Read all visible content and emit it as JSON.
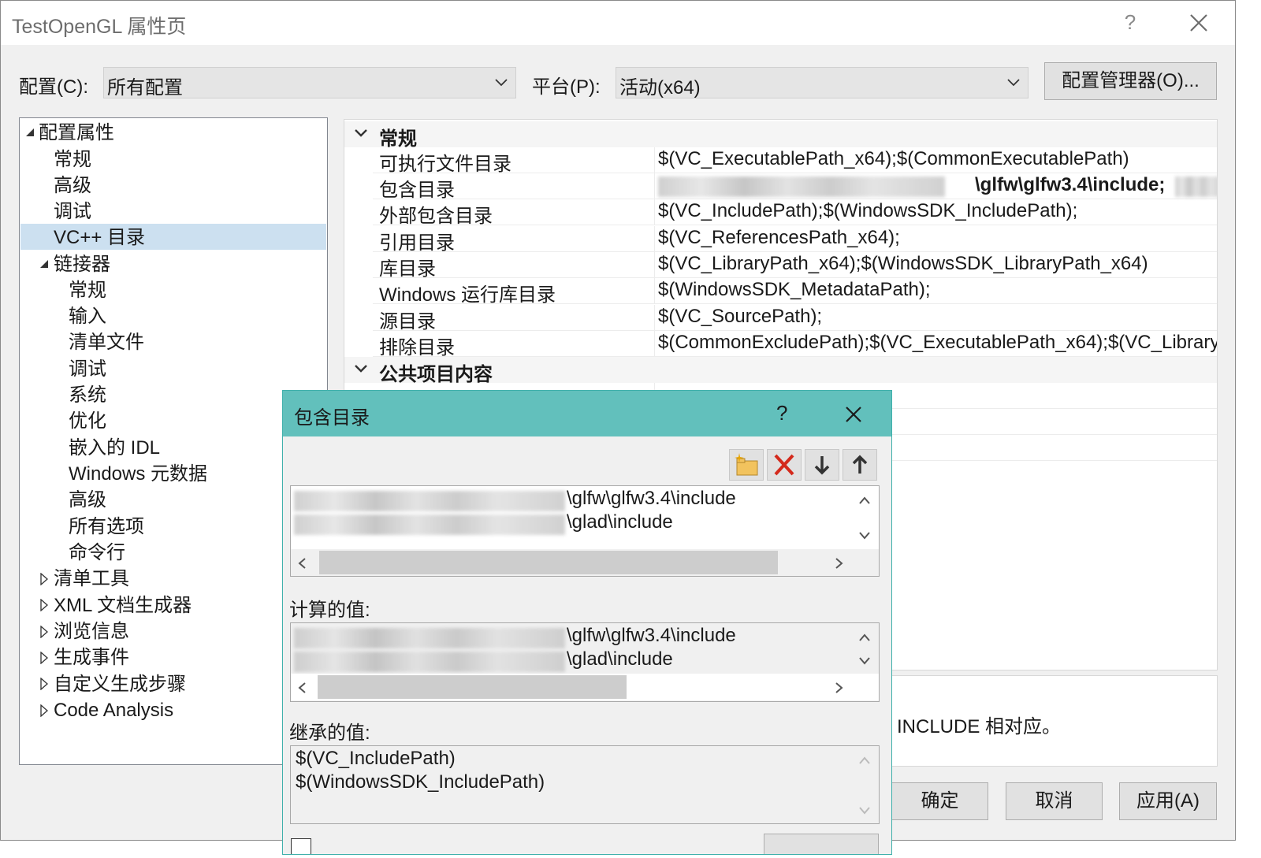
{
  "window": {
    "title": "TestOpenGL 属性页",
    "help": "?"
  },
  "toolbar": {
    "config_label": "配置(C):",
    "config_value": "所有配置",
    "platform_label": "平台(P):",
    "platform_value": "活动(x64)",
    "config_manager": "配置管理器(O)..."
  },
  "tree": {
    "items": [
      {
        "label": "配置属性"
      },
      {
        "label": "常规"
      },
      {
        "label": "高级"
      },
      {
        "label": "调试"
      },
      {
        "label": "VC++ 目录"
      },
      {
        "label": "链接器"
      },
      {
        "label": "常规"
      },
      {
        "label": "输入"
      },
      {
        "label": "清单文件"
      },
      {
        "label": "调试"
      },
      {
        "label": "系统"
      },
      {
        "label": "优化"
      },
      {
        "label": "嵌入的 IDL"
      },
      {
        "label": "Windows 元数据"
      },
      {
        "label": "高级"
      },
      {
        "label": "所有选项"
      },
      {
        "label": "命令行"
      },
      {
        "label": "清单工具"
      },
      {
        "label": "XML 文档生成器"
      },
      {
        "label": "浏览信息"
      },
      {
        "label": "生成事件"
      },
      {
        "label": "自定义生成步骤"
      },
      {
        "label": "Code Analysis"
      }
    ]
  },
  "grid": {
    "cat_general": "常规",
    "cat_public": "公共项目内容",
    "rows": [
      {
        "name": "可执行文件目录",
        "value": "$(VC_ExecutablePath_x64);$(CommonExecutablePath)"
      },
      {
        "name": "包含目录",
        "value": "\\glfw\\glfw3.4\\include;"
      },
      {
        "name": "外部包含目录",
        "value": "$(VC_IncludePath);$(WindowsSDK_IncludePath);"
      },
      {
        "name": "引用目录",
        "value": "$(VC_ReferencesPath_x64);"
      },
      {
        "name": "库目录",
        "value": "$(VC_LibraryPath_x64);$(WindowsSDK_LibraryPath_x64)"
      },
      {
        "name": "Windows 运行库目录",
        "value": "$(WindowsSDK_MetadataPath);"
      },
      {
        "name": "源目录",
        "value": "$(VC_SourcePath);"
      },
      {
        "name": "排除目录",
        "value": "$(CommonExcludePath);$(VC_ExecutablePath_x64);$(VC_Library"
      }
    ]
  },
  "description": {
    "text": "INCLUDE 相对应。"
  },
  "buttons": {
    "ok": "确定",
    "cancel": "取消",
    "apply": "应用(A)"
  },
  "dialog": {
    "title": "包含目录",
    "help": "?",
    "entries": [
      "\\glfw\\glfw3.4\\include",
      "\\glad\\include"
    ],
    "computed_label": "计算的值:",
    "computed": [
      "\\glfw\\glfw3.4\\include",
      "\\glad\\include"
    ],
    "inherited_label": "继承的值:",
    "inherited": [
      "$(VC_IncludePath)",
      "$(WindowsSDK_IncludePath)"
    ]
  },
  "colors": {
    "dialog_bar": "#62c0bc",
    "selection": "#cce0f0",
    "delete_red": "#d42a1c"
  },
  "icons": [
    "close-icon",
    "chevron-down-icon",
    "new-line-icon",
    "delete-icon",
    "move-down-icon",
    "move-up-icon"
  ]
}
